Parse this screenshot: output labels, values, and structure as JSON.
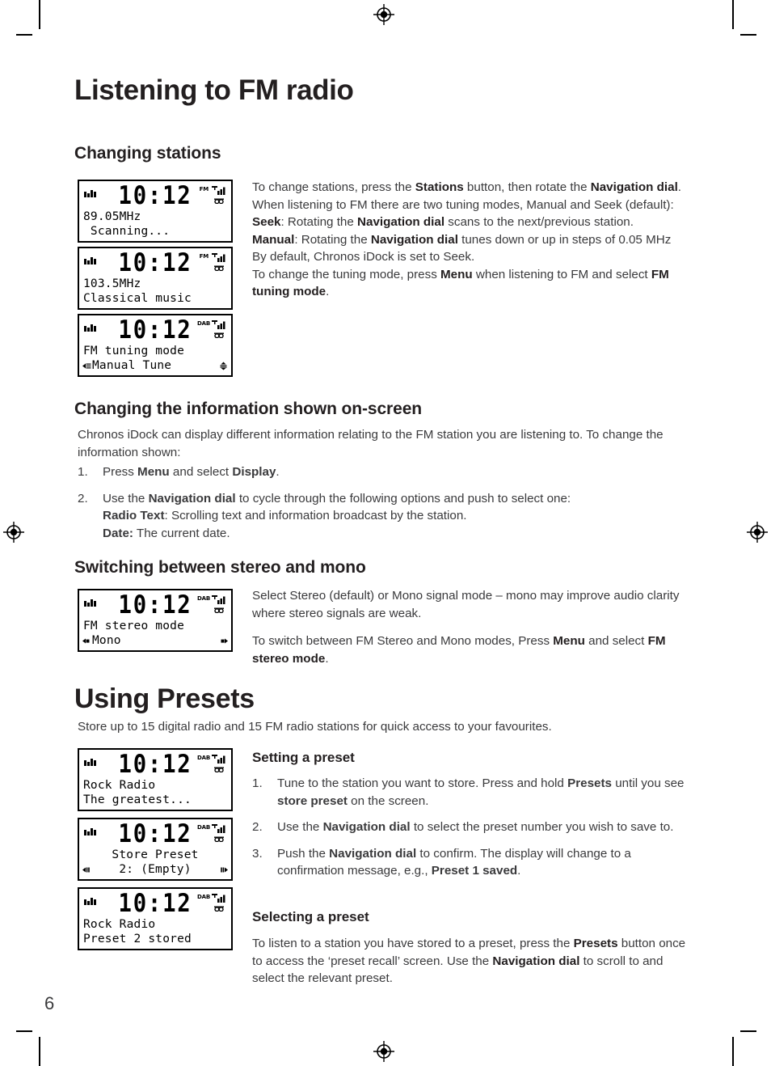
{
  "page": {
    "number": "6",
    "chapter_title": "Listening to FM radio"
  },
  "sections": [
    {
      "id": "changing-stations",
      "heading": "Changing stations",
      "paragraphs": [
        "To change stations, press the <b>Stations</b> button, then rotate the <b>Navigation dial</b>.",
        "When listening to FM there are two tuning modes, Manual and Seek (default):",
        "<b>Seek</b>: Rotating the <b>Navigation dial</b> scans to the next/previous station.",
        "<b>Manual</b>: Rotating the <b>Navigation dial</b> tunes down or up in steps of 0.05 MHz",
        "By default, Chronos iDock is set to Seek.",
        "To change the tuning mode, press <b>Menu</b> when listening to FM and select <b>FM tuning mode</b>."
      ]
    },
    {
      "id": "changing-information",
      "heading": "Changing the information shown on-screen",
      "intro": "Chronos iDock can display different information relating to the FM station you are listening to. To change the information shown:",
      "steps": [
        {
          "num": "1.",
          "text": "Press <b>Menu</b> and select <b>Display</b>."
        },
        {
          "num": "2.",
          "text": "Use the <b>Navigation dial</b> to cycle through the following options and push to select one:<br><b>Radio Text</b>: Scrolling text and information broadcast by the station.<br><b>Date:</b> The current date."
        }
      ]
    },
    {
      "id": "stereo-mono",
      "heading": "Switching between stereo and mono",
      "paragraphs": [
        "Select Stereo (default) or Mono signal mode &ndash; mono may improve audio clarity where stereo signals are weak.",
        "To switch between FM Stereo and Mono modes, Press <b>Menu</b> and select <b>FM stereo mode</b>."
      ]
    },
    {
      "id": "using-presets",
      "heading": "Using Presets",
      "intro": "Store up to 15 digital radio and 15 FM radio stations for quick access to your favourites."
    },
    {
      "id": "setting-a-preset",
      "heading": "Setting a preset",
      "steps": [
        {
          "num": "1.",
          "text": "Tune to the station you want to store. Press and hold <b>Presets</b> until you see <b>store preset</b> on the screen."
        },
        {
          "num": "2.",
          "text": "Use the <b>Navigation dial</b> to select the preset number you wish to save to."
        },
        {
          "num": "3.",
          "text": "Push the <b>Navigation dial</b> to confirm. The display will change to a confirmation message, e.g., <b>Preset 1 saved</b>."
        }
      ]
    },
    {
      "id": "selecting-a-preset",
      "heading": "Selecting a preset",
      "paragraphs": [
        "To listen to a station you have stored to a preset, press the <b>Presets</b> button once to access the &lsquo;preset recall&rsquo; screen. Use the <b>Navigation dial</b> to scroll to and select the relevant preset."
      ]
    }
  ],
  "lcd_screens": [
    {
      "id": "lcd-fm-scanning",
      "clock": "10:12",
      "band": "FM",
      "line1": "89.05MHz",
      "line2": " Scanning...",
      "line1_align": "left",
      "line2_align": "left",
      "arrow_left": "",
      "arrow_right": ""
    },
    {
      "id": "lcd-fm-classical",
      "clock": "10:12",
      "band": "FM",
      "line1": "103.5MHz",
      "line2": "Classical music",
      "line1_align": "left",
      "line2_align": "left",
      "arrow_left": "",
      "arrow_right": ""
    },
    {
      "id": "lcd-fm-tuning-mode",
      "clock": "10:12",
      "band": "DAB",
      "line1": "FM tuning mode",
      "line2": "Manual Tune",
      "line1_align": "left",
      "line2_align": "left",
      "arrow_left": "yes",
      "arrow_right": "yes"
    },
    {
      "id": "lcd-fm-stereo-mode",
      "clock": "10:12",
      "band": "DAB",
      "line1": "FM stereo mode",
      "line2": "Mono",
      "line1_align": "left",
      "line2_align": "left",
      "arrow_left": "yes",
      "arrow_right": "yes"
    },
    {
      "id": "lcd-rock-radio",
      "clock": "10:12",
      "band": "DAB",
      "line1": "Rock Radio",
      "line2": "The greatest...",
      "line1_align": "left",
      "line2_align": "left",
      "arrow_left": "",
      "arrow_right": ""
    },
    {
      "id": "lcd-store-preset",
      "clock": "10:12",
      "band": "DAB",
      "line1": "Store Preset",
      "line2": "2: (Empty)",
      "line1_align": "center",
      "line2_align": "center",
      "arrow_left": "yes",
      "arrow_right": "yes"
    },
    {
      "id": "lcd-preset-stored",
      "clock": "10:12",
      "band": "DAB",
      "line1": "Rock Radio",
      "line2": "Preset 2 stored",
      "line1_align": "left",
      "line2_align": "left",
      "arrow_left": "",
      "arrow_right": ""
    }
  ],
  "colors": {
    "text": "#231f20",
    "body": "#3a3a3c",
    "lcd_border": "#000000"
  }
}
